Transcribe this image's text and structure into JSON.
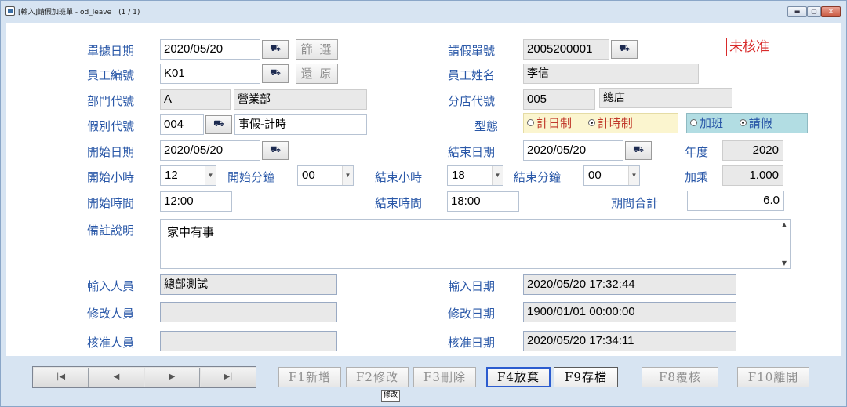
{
  "window": {
    "title": "[輸入]請假加班單 - od_leave　(1 / 1)",
    "min": "▬",
    "max": "▢",
    "close": "✕"
  },
  "status_badge": "未核准",
  "form": {
    "doc_date": {
      "label": "單據日期",
      "value": "2020/05/20"
    },
    "filter_btn": "篩 選",
    "restore_btn": "還 原",
    "leave_no": {
      "label": "請假單號",
      "value": "2005200001"
    },
    "emp_no": {
      "label": "員工編號",
      "value": "K01"
    },
    "emp_name": {
      "label": "員工姓名",
      "value": "李信"
    },
    "dept_code": {
      "label": "部門代號",
      "value": "A",
      "name": "營業部"
    },
    "branch_code": {
      "label": "分店代號",
      "value": "005",
      "name": "總店"
    },
    "leave_type": {
      "label": "假別代號",
      "value": "004",
      "name": "事假-計時"
    },
    "mode": {
      "label": "型態",
      "options": [
        "計日制",
        "計時制"
      ],
      "selected": "計時制"
    },
    "kind": {
      "options": [
        "加班",
        "請假"
      ],
      "selected": "請假"
    },
    "start_date": {
      "label": "開始日期",
      "value": "2020/05/20"
    },
    "end_date": {
      "label": "結束日期",
      "value": "2020/05/20"
    },
    "year": {
      "label": "年度",
      "value": "2020"
    },
    "start_hour": {
      "label": "開始小時",
      "value": "12"
    },
    "start_min": {
      "label": "開始分鐘",
      "value": "00"
    },
    "end_hour": {
      "label": "結束小時",
      "value": "18"
    },
    "end_min": {
      "label": "結束分鐘",
      "value": "00"
    },
    "multiplier": {
      "label": "加乘",
      "value": "1.000"
    },
    "start_time": {
      "label": "開始時間",
      "value": "12:00"
    },
    "end_time": {
      "label": "結束時間",
      "value": "18:00"
    },
    "total": {
      "label": "期間合計",
      "value": "6.0"
    },
    "memo": {
      "label": "備註說明",
      "value": "家中有事"
    },
    "input_user": {
      "label": "輸入人員",
      "value": "總部測試"
    },
    "input_date": {
      "label": "輸入日期",
      "value": "2020/05/20 17:32:44"
    },
    "modify_user": {
      "label": "修改人員",
      "value": ""
    },
    "modify_date": {
      "label": "修改日期",
      "value": "1900/01/01 00:00:00"
    },
    "approve_user": {
      "label": "核准人員",
      "value": ""
    },
    "approve_date": {
      "label": "核准日期",
      "value": "2020/05/20 17:34:11"
    }
  },
  "icons": {
    "lookup": "binoculars-icon",
    "nav_first": "first-record-icon",
    "nav_prev": "prev-record-icon",
    "nav_next": "next-record-icon",
    "nav_last": "last-record-icon"
  },
  "nav": {
    "first": "|◀",
    "prev": "◀",
    "next": "▶",
    "last": "▶|"
  },
  "buttons": {
    "f1": "F1新增",
    "f2": "F2修改",
    "f3": "F3刪除",
    "f4": "F4放棄",
    "f9": "F9存檔",
    "f8": "F8覆核",
    "f10": "F10離開"
  },
  "tooltip": "修改",
  "lookup_glyph": "⛟"
}
